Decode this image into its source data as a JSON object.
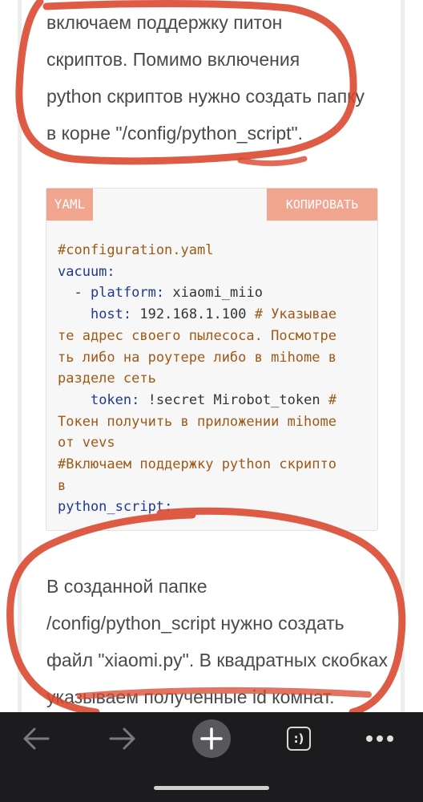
{
  "article": {
    "paragraph1": [
      "включаем поддержку питон",
      "скриптов. Помимо включения",
      "python скриптов нужно создать папку",
      "в корне \"/config/python_script\"."
    ],
    "paragraph2": [
      "В созданной папке",
      "/config/python_script нужно создать",
      "файл \"xiaomi.py\". В квадратных скобках",
      "указываем полученные id комнат."
    ]
  },
  "code_block": {
    "language": "YAML",
    "copy_label": "КОПИРОВАТЬ",
    "comment1": "#configuration.yaml",
    "vacuum_key": "vacuum",
    "platform_key": "platform",
    "platform_value": "xiaomi_miio",
    "host_key": "host",
    "host_value": "192.168.1.100",
    "host_comment_lines": [
      "# Указывае",
      "те адрес своего пылесоса. Посмотре",
      "ть либо на роутере либо в mihome в",
      "разделе сеть"
    ],
    "token_key": "token",
    "token_value": "!secret Mirobot_token",
    "token_comment_lines": [
      "#",
      "Токен получить в приложении mihome",
      "от vevs"
    ],
    "python_comment_lines": [
      "#Включаем поддержку python скрипто",
      "в"
    ],
    "python_key": "python_script"
  },
  "colors": {
    "annotation": "#d9462c",
    "header_accent": "#f0a58e",
    "comment": "#9c5a18",
    "key": "#1f3a8c"
  },
  "toolbar": {
    "back_icon": "arrow-left-icon",
    "forward_icon": "arrow-right-icon",
    "new_tab_icon": "plus-icon",
    "tabs_label": ":)",
    "more_icon": "more-dots-icon"
  }
}
